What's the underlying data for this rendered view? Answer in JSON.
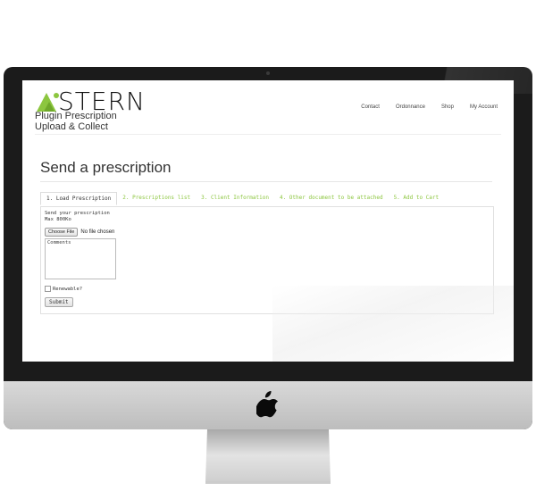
{
  "header": {
    "logo_word": "STERN",
    "logo_sub_line1": "Plugin Prescription",
    "logo_sub_line2": "Upload & Collect",
    "nav": [
      "Contact",
      "Ordonnance",
      "Shop",
      "My Account"
    ]
  },
  "page": {
    "title": "Send a prescription"
  },
  "tabs": [
    "1. Load Prescription",
    "2. Prescriptions list",
    "3. Client Information",
    "4. Other document to be attached",
    "5. Add to Cart"
  ],
  "form": {
    "intro": "Send your prescription",
    "max_size": "Max 800Ko",
    "choose_file": "Choose File",
    "file_status": "No file chosen",
    "comments_placeholder": "Comments",
    "renewable_label": "Renewable?",
    "submit_label": "Submit"
  },
  "colors": {
    "accent_green": "#8cc63f",
    "bezel": "#1b1b1b",
    "chin": "#cfcfcf"
  },
  "icons": {
    "brand": "stern-triangle-logo",
    "device": "apple-logo"
  }
}
